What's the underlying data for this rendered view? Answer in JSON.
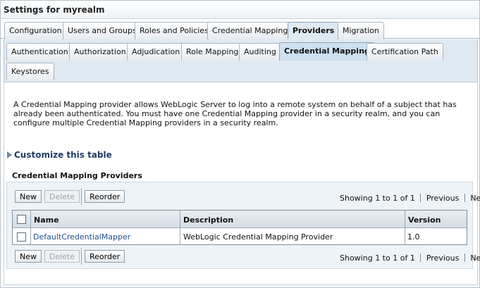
{
  "page": {
    "title": "Settings for myrealm"
  },
  "tabs_main": [
    {
      "label": "Configuration"
    },
    {
      "label": "Users and Groups"
    },
    {
      "label": "Roles and Policies"
    },
    {
      "label": "Credential Mappings"
    },
    {
      "label": "Providers",
      "active": true
    },
    {
      "label": "Migration"
    }
  ],
  "tabs_sub": [
    {
      "label": "Authentication"
    },
    {
      "label": "Authorization"
    },
    {
      "label": "Adjudication"
    },
    {
      "label": "Role Mapping"
    },
    {
      "label": "Auditing"
    },
    {
      "label": "Credential Mapping",
      "active": true
    },
    {
      "label": "Certification Path"
    },
    {
      "label": "Keystores"
    }
  ],
  "description": "A Credential Mapping provider allows WebLogic Server to log into a remote system on behalf of a subject that has already been authenticated. You must have one Credential Mapping provider in a security realm, and you can configure multiple Credential Mapping providers in a security realm.",
  "customize_link": "Customize this table",
  "table": {
    "title": "Credential Mapping Providers",
    "buttons": {
      "new": "New",
      "delete": "Delete",
      "reorder": "Reorder"
    },
    "paging": {
      "showing": "Showing 1 to 1 of 1",
      "previous": "Previous",
      "next": "Next"
    },
    "columns": [
      "Name",
      "Description",
      "Version"
    ],
    "rows": [
      {
        "name": "DefaultCredentialMapper",
        "description": "WebLogic Credential Mapping Provider",
        "version": "1.0"
      }
    ]
  },
  "colors": {
    "accent": "#1f3c66",
    "active_tab": "#dfe9f2",
    "link": "#1f4f8a"
  },
  "icons": {
    "customize": "expand-triangle-icon"
  }
}
